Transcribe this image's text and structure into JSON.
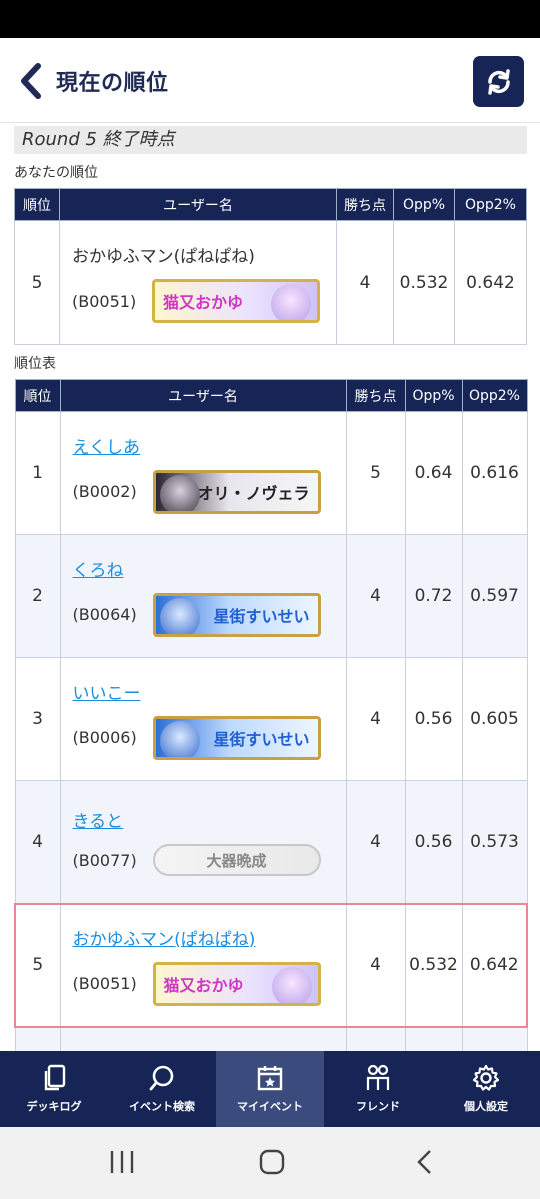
{
  "header": {
    "title": "現在の順位"
  },
  "round_label": "Round 5 終了時点",
  "my_rank_label": "あなたの順位",
  "standings_label": "順位表",
  "columns": {
    "rank": "順位",
    "user": "ユーザー名",
    "points": "勝ち点",
    "opp": "Opp%",
    "opp2": "Opp2%"
  },
  "my_rank": {
    "rank": "5",
    "name": "おかゆふマン(ぱねぱね)",
    "id": "(B0051)",
    "badge": "猫又おかゆ",
    "points": "4",
    "opp": "0.532",
    "opp2": "0.642"
  },
  "standings": [
    {
      "rank": "1",
      "name": "えくしあ",
      "id": "(B0002)",
      "badge": "シオリ・ノヴェラ",
      "points": "5",
      "opp": "0.64",
      "opp2": "0.616"
    },
    {
      "rank": "2",
      "name": "くろね",
      "id": "(B0064)",
      "badge": "星街すいせい",
      "points": "4",
      "opp": "0.72",
      "opp2": "0.597"
    },
    {
      "rank": "3",
      "name": "いいこー",
      "id": "(B0006)",
      "badge": "星街すいせい",
      "points": "4",
      "opp": "0.56",
      "opp2": "0.605"
    },
    {
      "rank": "4",
      "name": "きると",
      "id": "(B0077)",
      "badge": "大器晩成",
      "points": "4",
      "opp": "0.56",
      "opp2": "0.573"
    },
    {
      "rank": "5",
      "name": "おかゆふマン(ぱねぱね)",
      "id": "(B0051)",
      "badge": "猫又おかゆ",
      "points": "4",
      "opp": "0.532",
      "opp2": "0.642"
    }
  ],
  "tabs": [
    {
      "label": "デッキログ",
      "icon": "copy-icon"
    },
    {
      "label": "イベント検索",
      "icon": "search-icon"
    },
    {
      "label": "マイイベント",
      "icon": "calendar-star-icon"
    },
    {
      "label": "フレンド",
      "icon": "friends-icon"
    },
    {
      "label": "個人設定",
      "icon": "gear-icon"
    }
  ],
  "colors": {
    "navy": "#172556",
    "active_tab": "#3b4b7d",
    "link": "#1a8de0",
    "highlight_border": "#e58a93"
  }
}
